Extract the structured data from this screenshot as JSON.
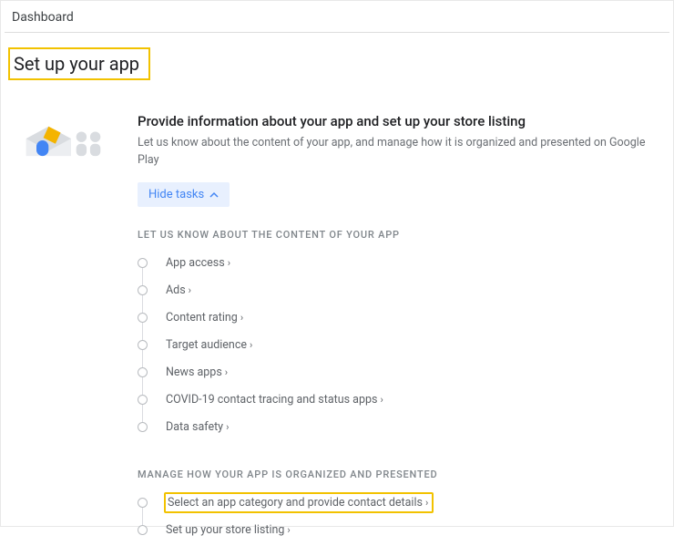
{
  "breadcrumb": "Dashboard",
  "page_title": "Set up your app",
  "card": {
    "title": "Provide information about your app and set up your store listing",
    "description": "Let us know about the content of your app, and manage how it is organized and presented on Google Play",
    "hide_tasks_label": "Hide tasks"
  },
  "section1": {
    "label": "LET US KNOW ABOUT THE CONTENT OF YOUR APP",
    "items": [
      {
        "label": "App access"
      },
      {
        "label": "Ads"
      },
      {
        "label": "Content rating"
      },
      {
        "label": "Target audience"
      },
      {
        "label": "News apps"
      },
      {
        "label": "COVID-19 contact tracing and status apps"
      },
      {
        "label": "Data safety"
      }
    ]
  },
  "section2": {
    "label": "MANAGE HOW YOUR APP IS ORGANIZED AND PRESENTED",
    "items": [
      {
        "label": "Select an app category and provide contact details"
      },
      {
        "label": "Set up your store listing"
      }
    ]
  },
  "colors": {
    "highlight_border": "#f2c200",
    "accent": "#4285f4"
  }
}
